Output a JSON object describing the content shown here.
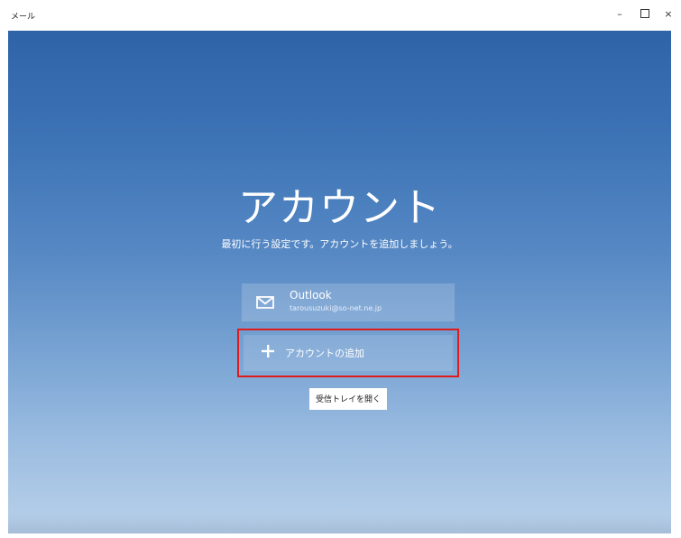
{
  "window": {
    "title": "メール",
    "controls": {
      "minimize": "–",
      "maximize_icon": "maximize-icon",
      "close": "×"
    }
  },
  "main": {
    "heading": "アカウント",
    "subtitle": "最初に行う設定です。アカウントを追加しましょう。",
    "account": {
      "icon": "mail-icon",
      "name": "Outlook",
      "email": "tarousuzuki@so-net.ne.jp"
    },
    "add_account": {
      "icon": "plus-icon",
      "label": "アカウントの追加",
      "highlight_color": "#e01b1b"
    },
    "open_inbox_label": "受信トレイを開く"
  },
  "colors": {
    "sky_top": "#2f63a8",
    "sky_bottom": "#b9d1ea"
  }
}
